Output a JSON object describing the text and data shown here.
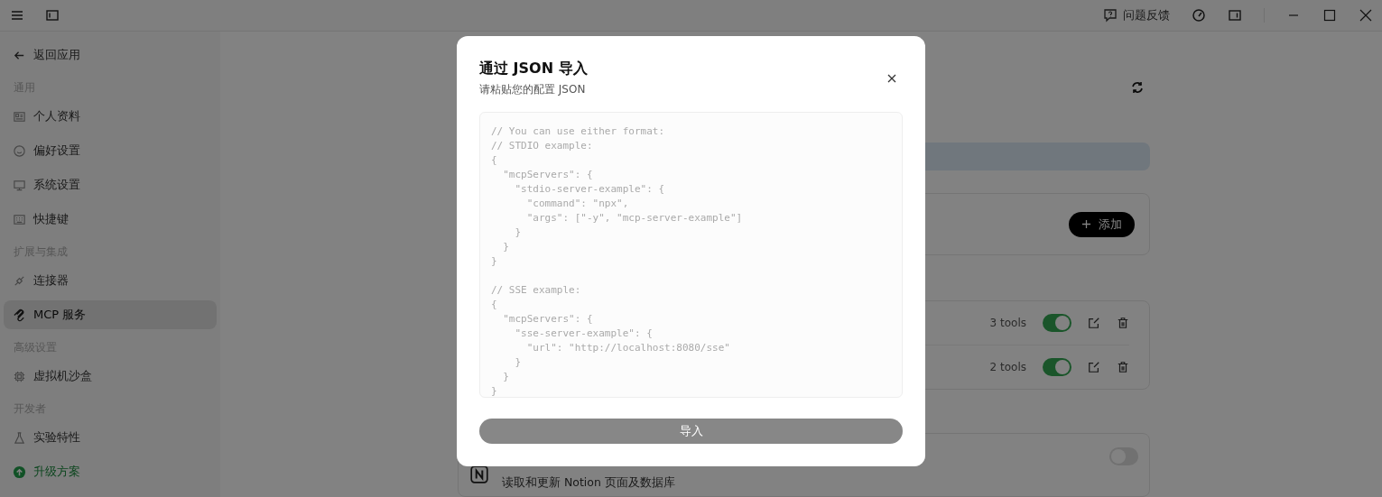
{
  "title_bar": {
    "feedback": "问题反馈"
  },
  "sidebar": {
    "back": "返回应用",
    "sections": [
      {
        "header": "通用",
        "items": [
          {
            "label": "个人资料",
            "selected": false,
            "kind": "normal"
          },
          {
            "label": "偏好设置",
            "selected": false,
            "kind": "normal"
          },
          {
            "label": "系统设置",
            "selected": false,
            "kind": "normal"
          },
          {
            "label": "快捷键",
            "selected": false,
            "kind": "normal"
          }
        ]
      },
      {
        "header": "扩展与集成",
        "items": [
          {
            "label": "连接器",
            "selected": false,
            "kind": "normal"
          },
          {
            "label": "MCP 服务",
            "selected": true,
            "kind": "normal"
          }
        ]
      },
      {
        "header": "高级设置",
        "items": [
          {
            "label": "虚拟机沙盒",
            "selected": false,
            "kind": "normal"
          }
        ]
      },
      {
        "header": "开发者",
        "items": [
          {
            "label": "实验特性",
            "selected": false,
            "kind": "normal"
          },
          {
            "label": "升级方案",
            "selected": false,
            "kind": "upgrade"
          }
        ]
      }
    ]
  },
  "main": {
    "add_button": "添加",
    "servers": [
      {
        "tools": "3 tools",
        "on": true
      },
      {
        "tools": "2 tools",
        "on": true
      }
    ],
    "connector": {
      "description": "读取和更新 Notion 页面及数据库",
      "on": false
    }
  },
  "dialog": {
    "title": "通过 JSON 导入",
    "subtitle": "请粘贴您的配置 JSON",
    "placeholder": "// You can use either format:\n// STDIO example:\n{\n  \"mcpServers\": {\n    \"stdio-server-example\": {\n      \"command\": \"npx\",\n      \"args\": [\"-y\", \"mcp-server-example\"]\n    }\n  }\n}\n\n// SSE example:\n{\n  \"mcpServers\": {\n    \"sse-server-example\": {\n      \"url\": \"http://localhost:8080/sse\"\n    }\n  }\n}",
    "import_button": {
      "label": "导入",
      "disabled": true
    }
  }
}
